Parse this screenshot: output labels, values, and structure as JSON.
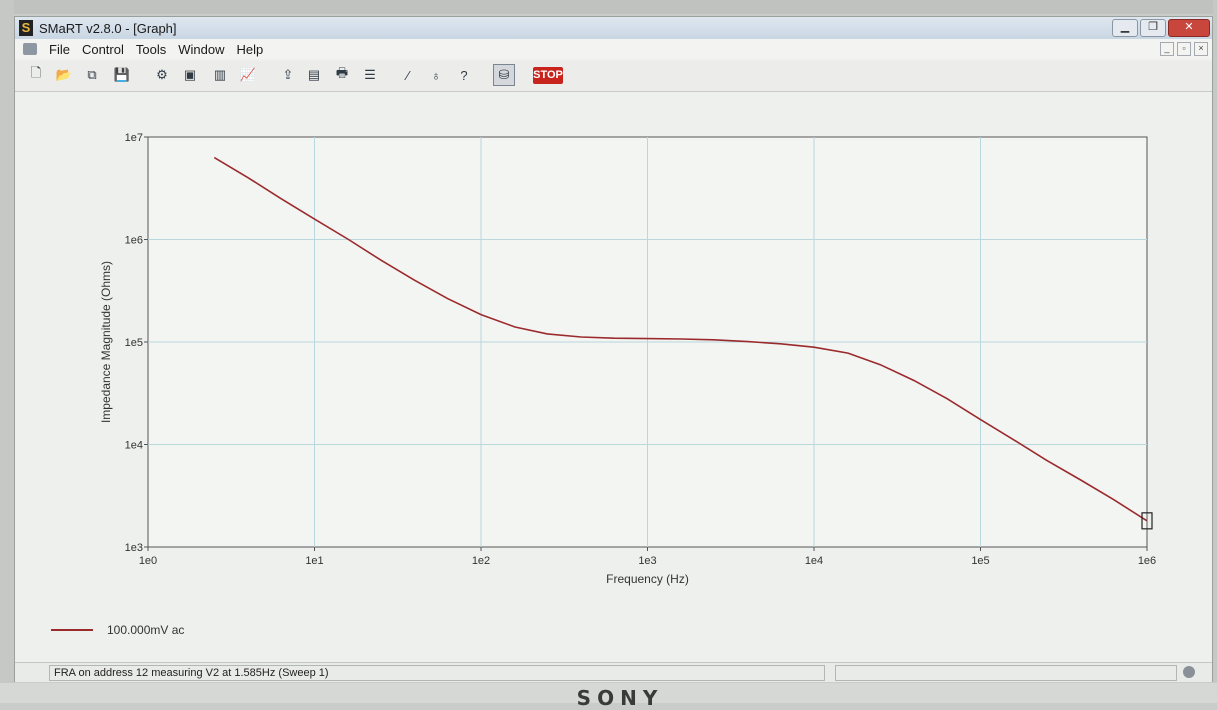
{
  "window": {
    "title": "SMaRT v2.8.0 - [Graph]",
    "controls": {
      "minimize": "▁",
      "restore": "❐",
      "close": "✕"
    }
  },
  "menubar": {
    "items": [
      "File",
      "Control",
      "Tools",
      "Window",
      "Help"
    ]
  },
  "toolbar": {
    "buttons": [
      {
        "name": "new-icon",
        "glyph": "🗋"
      },
      {
        "name": "open-icon",
        "glyph": "📂"
      },
      {
        "name": "copy-icon",
        "glyph": "⧉"
      },
      {
        "name": "save-icon",
        "glyph": "💾"
      },
      {
        "name": "instrument-icon",
        "glyph": "⚙"
      },
      {
        "name": "display-icon",
        "glyph": "▣"
      },
      {
        "name": "chart-bar-icon",
        "glyph": "▥"
      },
      {
        "name": "graph-icon",
        "glyph": "📈"
      },
      {
        "name": "export-icon",
        "glyph": "⇪"
      },
      {
        "name": "table-icon",
        "glyph": "▤"
      },
      {
        "name": "print-icon",
        "glyph": "🖶"
      },
      {
        "name": "settings-icon",
        "glyph": "☰"
      },
      {
        "name": "wand-icon",
        "glyph": "⁄"
      },
      {
        "name": "tip-icon",
        "glyph": "♁"
      },
      {
        "name": "help-icon",
        "glyph": "?"
      },
      {
        "name": "run-icon",
        "glyph": "⛁"
      }
    ],
    "stop_label": "STOP",
    "stop_color": "#c8241d"
  },
  "chart_data": {
    "type": "line",
    "x_scale": "log",
    "y_scale": "log",
    "xlim": [
      1,
      1000000
    ],
    "ylim": [
      1000,
      10000000
    ],
    "xticks": [
      "1e0",
      "1e1",
      "1e2",
      "1e3",
      "1e4",
      "1e5",
      "1e6"
    ],
    "yticks": [
      "1e3",
      "1e4",
      "1e5",
      "1e6",
      "1e7"
    ],
    "xlabel": "Frequency (Hz)",
    "ylabel": "Impedance Magnitude (Ohms)",
    "grid": true,
    "legend": "bottom-left",
    "series": [
      {
        "name": "100.000mV ac",
        "color": "#9b2a2c",
        "x": [
          2.5,
          4,
          6.3,
          10,
          16,
          25,
          40,
          63,
          100,
          160,
          250,
          400,
          630,
          1000,
          1600,
          2500,
          4000,
          6300,
          10000,
          16000,
          25000,
          40000,
          63000,
          100000,
          160000,
          250000,
          400000,
          630000,
          1000000
        ],
        "y": [
          6300000,
          4000000,
          2500000,
          1580000,
          1000000,
          630000,
          400000,
          265000,
          185000,
          140000,
          120000,
          112000,
          109000,
          108000,
          107000,
          105000,
          101000,
          96000,
          89000,
          78000,
          60000,
          42000,
          28000,
          17500,
          11000,
          7000,
          4500,
          2900,
          1800
        ]
      }
    ],
    "marker": {
      "x": 1000000,
      "y": 1800
    }
  },
  "legend": {
    "label": "100.000mV ac"
  },
  "status": {
    "text": "FRA on address 12 measuring V2 at 1.585Hz (Sweep 1)"
  },
  "brand": "SONY"
}
